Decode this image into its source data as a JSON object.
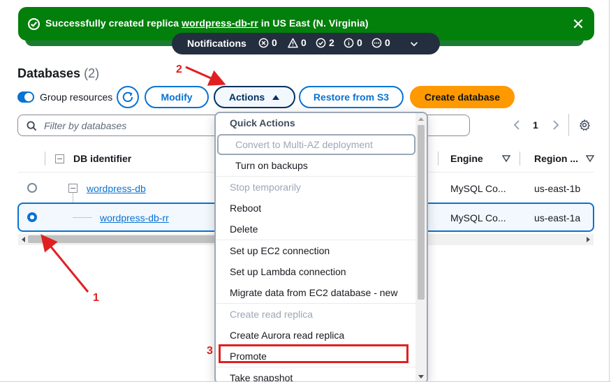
{
  "flash": {
    "message_prefix": "Successfully created replica ",
    "replica_link": "wordpress-db-rr",
    "message_suffix": " in US East (N. Virginia)"
  },
  "notifications": {
    "title": "Notifications",
    "counts": {
      "error": "0",
      "warning": "0",
      "success": "2",
      "info": "0",
      "in_progress": "0"
    }
  },
  "header": {
    "title": "Databases",
    "count": "(2)"
  },
  "toolbar": {
    "group_resources_label": "Group resources",
    "modify_label": "Modify",
    "actions_label": "Actions",
    "restore_label": "Restore from S3",
    "create_label": "Create database"
  },
  "filter": {
    "placeholder": "Filter by databases"
  },
  "pagination": {
    "current_page": "1"
  },
  "table": {
    "columns": {
      "db_identifier": "DB identifier",
      "engine": "Engine",
      "region": "Region ..."
    },
    "rows": [
      {
        "identifier": "wordpress-db",
        "engine": "MySQL Co...",
        "region": "us-east-1b",
        "selected": false
      },
      {
        "identifier": "wordpress-db-rr",
        "engine": "MySQL Co...",
        "region": "us-east-1a",
        "selected": true
      }
    ]
  },
  "actions_menu": {
    "header": "Quick Actions",
    "items": [
      {
        "label": "Convert to Multi-AZ deployment",
        "disabled": true
      },
      {
        "label": "Turn on backups",
        "disabled": false
      },
      {
        "label": "Stop temporarily",
        "disabled": true
      },
      {
        "label": "Reboot",
        "disabled": false
      },
      {
        "label": "Delete",
        "disabled": false
      },
      {
        "label": "Set up EC2 connection",
        "disabled": false
      },
      {
        "label": "Set up Lambda connection",
        "disabled": false
      },
      {
        "label": "Migrate data from EC2 database - new",
        "disabled": false
      },
      {
        "label": "Create read replica",
        "disabled": true
      },
      {
        "label": "Create Aurora read replica",
        "disabled": false
      },
      {
        "label": "Promote",
        "disabled": false
      },
      {
        "label": "Take snapshot",
        "disabled": false
      }
    ]
  },
  "annotations": {
    "step1": "1",
    "step2": "2",
    "step3": "3"
  },
  "colors": {
    "success": "#037f0c",
    "accent": "#0972d3",
    "primary": "#ff9900",
    "annotation": "#e02020",
    "notification_bg": "#232f3e"
  }
}
